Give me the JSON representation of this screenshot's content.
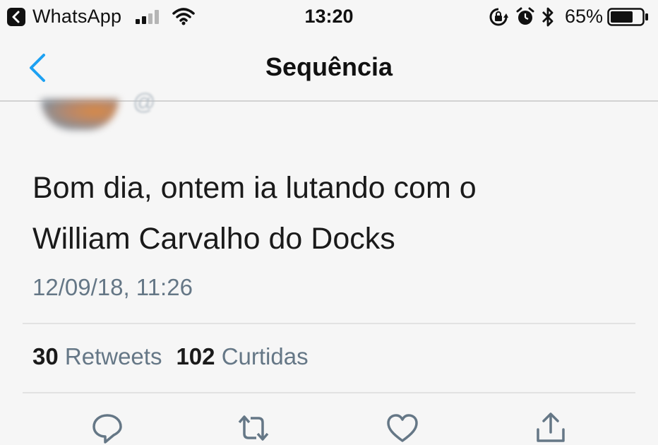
{
  "status_bar": {
    "back_app": "WhatsApp",
    "time": "13:20",
    "battery_percent": "65%",
    "icons": [
      "back-arrow-icon",
      "signal-icon",
      "wifi-icon",
      "rotation-lock-icon",
      "alarm-icon",
      "bluetooth-icon",
      "battery-icon"
    ]
  },
  "nav": {
    "title": "Sequência",
    "back_icon": "chevron-left-icon",
    "accent_color": "#1da1f2"
  },
  "tweet": {
    "text_line1": "Bom dia, ontem ia lutando com o",
    "text_line2": "William Carvalho do Docks",
    "date": "12/09/18, 11:26",
    "retweets_count": "30",
    "retweets_label": "Retweets",
    "likes_count": "102",
    "likes_label": "Curtidas"
  },
  "actions": [
    {
      "icon": "reply-icon"
    },
    {
      "icon": "retweet-icon"
    },
    {
      "icon": "like-icon"
    },
    {
      "icon": "share-icon"
    }
  ]
}
